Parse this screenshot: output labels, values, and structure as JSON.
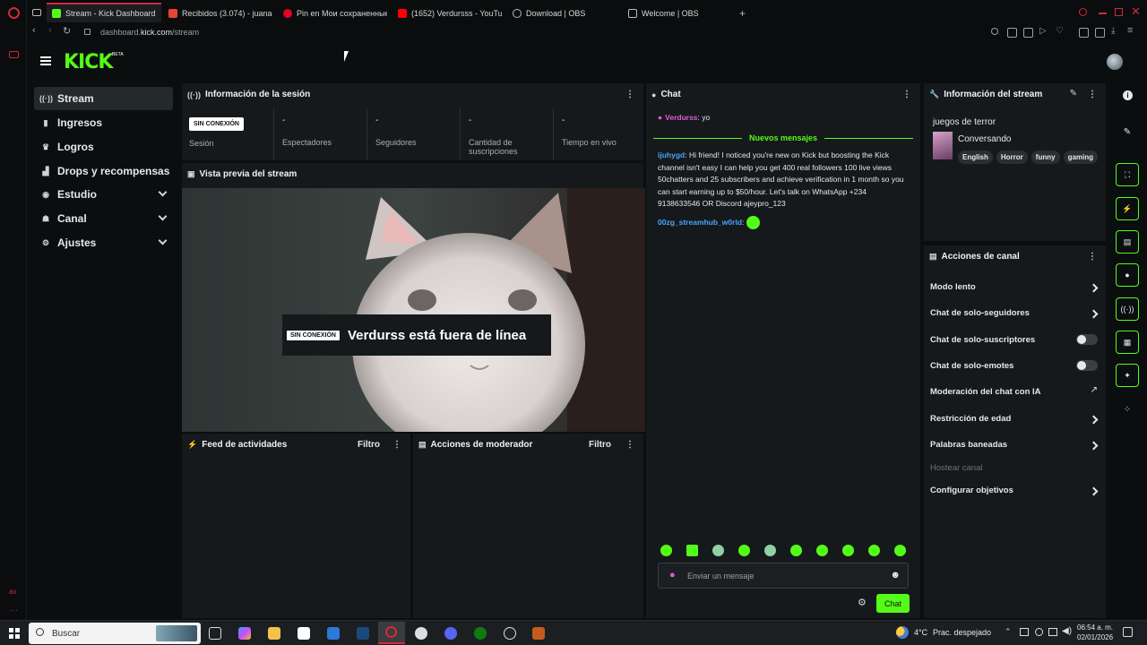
{
  "browser": {
    "tabs": [
      {
        "title": "Stream - Kick Dashboard",
        "icon": "kick-favicon",
        "color": "#53fc18",
        "active": true
      },
      {
        "title": "Recibidos (3.074) - juana",
        "icon": "gmail-favicon",
        "color": "#ea4335"
      },
      {
        "title": "Pin en Мои сохраненные",
        "icon": "pinterest-favicon",
        "color": "#e60023"
      },
      {
        "title": "(1652) Verdursss - YouTu",
        "icon": "youtube-favicon",
        "color": "#ff0000"
      },
      {
        "title": "Download | OBS",
        "icon": "obs-favicon",
        "color": "#bbbbbb"
      },
      {
        "title": "Welcome | OBS",
        "icon": "page-favicon",
        "color": "#bbbbbb"
      }
    ],
    "new_tab": "+",
    "url_prefix": "dashboard.",
    "url_host": "kick.com",
    "url_path": "/stream"
  },
  "kick": {
    "logo": "KICK",
    "beta": "BETA"
  },
  "sidebar": {
    "items": [
      {
        "label": "Stream",
        "icon": "stream-icon",
        "glyph": "((·))",
        "active": true
      },
      {
        "label": "Ingresos",
        "icon": "money-icon",
        "glyph": "▮"
      },
      {
        "label": "Logros",
        "icon": "trophy-icon",
        "glyph": "♛"
      },
      {
        "label": "Drops y recompensas",
        "icon": "chart-icon",
        "glyph": "▟"
      },
      {
        "label": "Estudio",
        "icon": "studio-icon",
        "glyph": "◉",
        "expandable": true
      },
      {
        "label": "Canal",
        "icon": "channel-icon",
        "glyph": "☗",
        "expandable": true
      },
      {
        "label": "Ajustes",
        "icon": "settings-icon",
        "glyph": "⚙",
        "expandable": true
      }
    ]
  },
  "session": {
    "title": "Información de la sesión",
    "offline_badge": "SIN CONEXIÓN",
    "session_label": "Sesión",
    "stats": [
      {
        "value": "-",
        "label": "Espectadores"
      },
      {
        "value": "-",
        "label": "Seguidores"
      },
      {
        "value": "-",
        "label": "Cantidad de suscripciones"
      },
      {
        "value": "-",
        "label": "Tiempo en vivo"
      }
    ]
  },
  "preview": {
    "title": "Vista previa del stream",
    "badge": "SIN CONEXIÓN",
    "offline_text": "Verdurss está fuera de línea"
  },
  "activity": {
    "title": "Feed de actividades",
    "filter": "Filtro"
  },
  "modactions": {
    "title": "Acciones de moderador",
    "filter": "Filtro"
  },
  "chat": {
    "title": "Chat",
    "pinned": {
      "user": "Verdurss",
      "text": "yo",
      "user_color": "#e35bd6"
    },
    "new_messages": "Nuevos mensajes",
    "messages": [
      {
        "user": "ijuhygd",
        "user_color": "#4aa3ff",
        "text": "Hi friend! I noticed you're new on Kick but boosting the Kick channel isn't easy I can help you get 400 real followers 100 live views 50chatters and 25 subscribers and achieve verification in 1 month so you can start earning up to $50/hour. Let's talk on WhatsApp +234 9138633546 OR Discord ajeypro_123"
      },
      {
        "user": "00zg_streamhub_w0rld",
        "user_color": "#4aa3ff",
        "text": ""
      }
    ],
    "input_placeholder": "Enviar un mensaje",
    "send_label": "Chat"
  },
  "stream_info": {
    "title": "Información del stream",
    "stream_title": "juegos de terror",
    "category": "Conversando",
    "tags": [
      "English",
      "Horror",
      "funny",
      "gaming"
    ]
  },
  "channel_actions": {
    "title": "Acciones de canal",
    "items": [
      {
        "label": "Modo lento",
        "control": "chevron"
      },
      {
        "label": "Chat de solo-seguidores",
        "control": "chevron"
      },
      {
        "label": "Chat de solo-suscriptores",
        "control": "toggle",
        "state": "off"
      },
      {
        "label": "Chat de solo-emotes",
        "control": "toggle",
        "state": "off"
      },
      {
        "label": "Moderación del chat con IA",
        "control": "external"
      },
      {
        "label": "Restricción de edad",
        "control": "chevron"
      },
      {
        "label": "Palabras baneadas",
        "control": "chevron"
      },
      {
        "label": "Hostear canal",
        "control": "none",
        "disabled": true
      },
      {
        "label": "Configurar objetivos",
        "control": "chevron"
      }
    ]
  },
  "rail": [
    "info-icon",
    "edit-icon",
    "scan-icon",
    "bolt-icon",
    "notes-icon",
    "chat-bubble-icon",
    "broadcast-icon",
    "layout-icon",
    "wrench-icon",
    "apps-icon"
  ],
  "taskbar": {
    "search": "Buscar",
    "weather_temp": "4°C",
    "weather_desc": "Prac. despejado",
    "time": "06:54 a. m.",
    "date": "02/01/2026"
  },
  "colors": {
    "accent": "#53fc18",
    "panel": "#15191b",
    "bg": "#0b0e0f",
    "opera_red": "#d22a3c"
  }
}
